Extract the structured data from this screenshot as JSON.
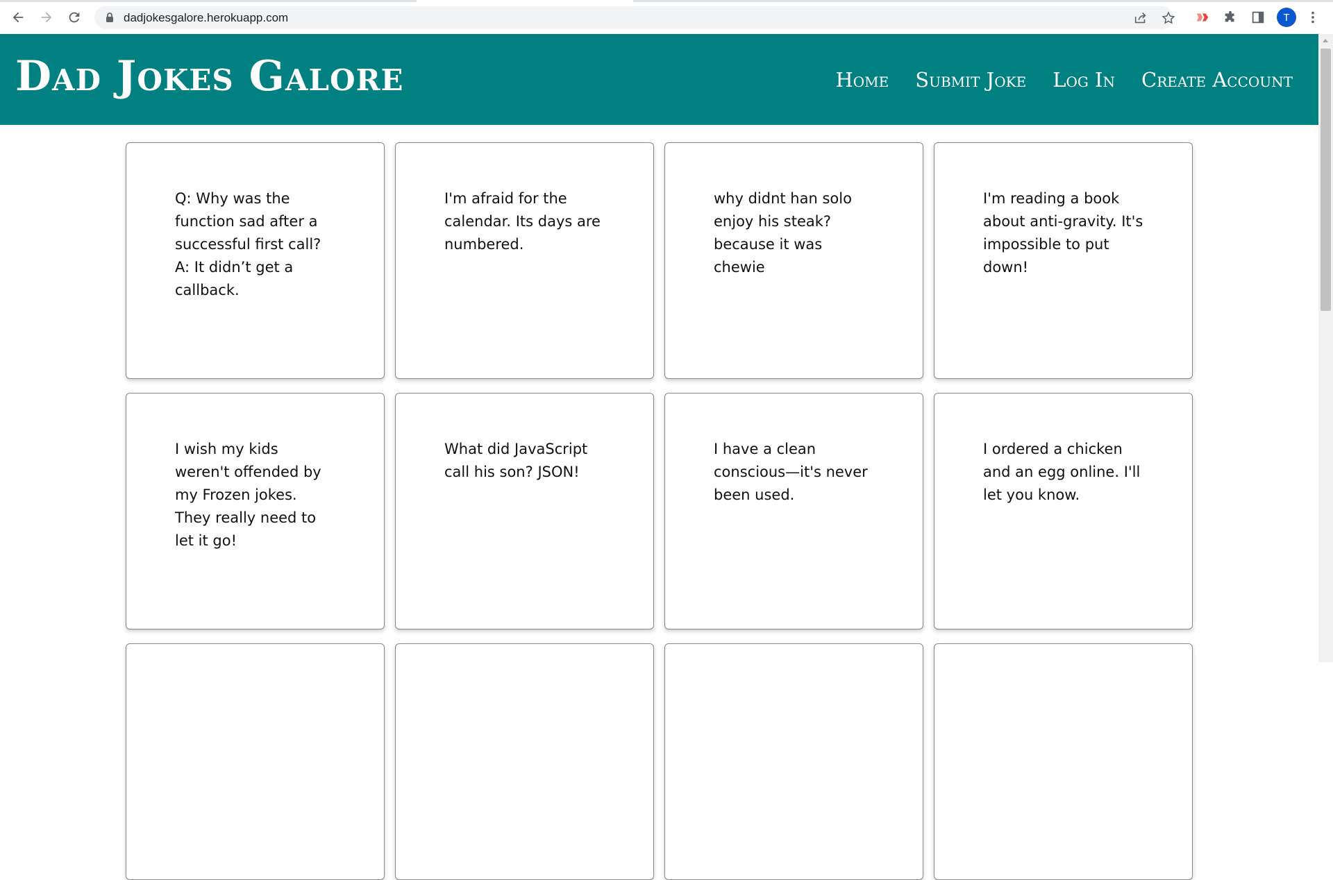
{
  "browser": {
    "url": "dadjokesgalore.herokuapp.com",
    "profile_initial": "T"
  },
  "site": {
    "title": "Dad Jokes Galore",
    "nav": [
      {
        "label": "Home"
      },
      {
        "label": "Submit Joke"
      },
      {
        "label": "Log In"
      },
      {
        "label": "Create Account"
      }
    ]
  },
  "jokes": [
    {
      "text": "Q: Why was the function sad after a successful first call? A: It didn’t get a callback."
    },
    {
      "text": "I'm afraid for the calendar. Its days are numbered."
    },
    {
      "text": "why didnt han solo enjoy his steak? because it was chewie"
    },
    {
      "text": "I'm reading a book about anti-gravity. It's impossible to put down!"
    },
    {
      "text": "I wish my kids weren't offended by my Frozen jokes. They really need to let it go!"
    },
    {
      "text": "What did JavaScript call his son? JSON!"
    },
    {
      "text": "I have a clean conscious—it's never been used."
    },
    {
      "text": "I ordered a chicken and an egg online. I'll let you know."
    },
    {
      "text": ""
    },
    {
      "text": ""
    },
    {
      "text": ""
    },
    {
      "text": ""
    }
  ],
  "colors": {
    "header_bg": "#008080",
    "header_text": "#ffffff",
    "card_border": "#8a8a8a",
    "profile_avatar": "#0b57d0"
  },
  "icons": {
    "back": "back-arrow-icon",
    "forward": "forward-arrow-icon",
    "reload": "reload-icon",
    "lock": "lock-icon",
    "share": "share-icon",
    "bookmark": "star-icon",
    "extension_red": "red-extension-icon",
    "extensions": "puzzle-piece-icon",
    "side_panel": "side-panel-icon",
    "menu": "kebab-menu-icon"
  }
}
